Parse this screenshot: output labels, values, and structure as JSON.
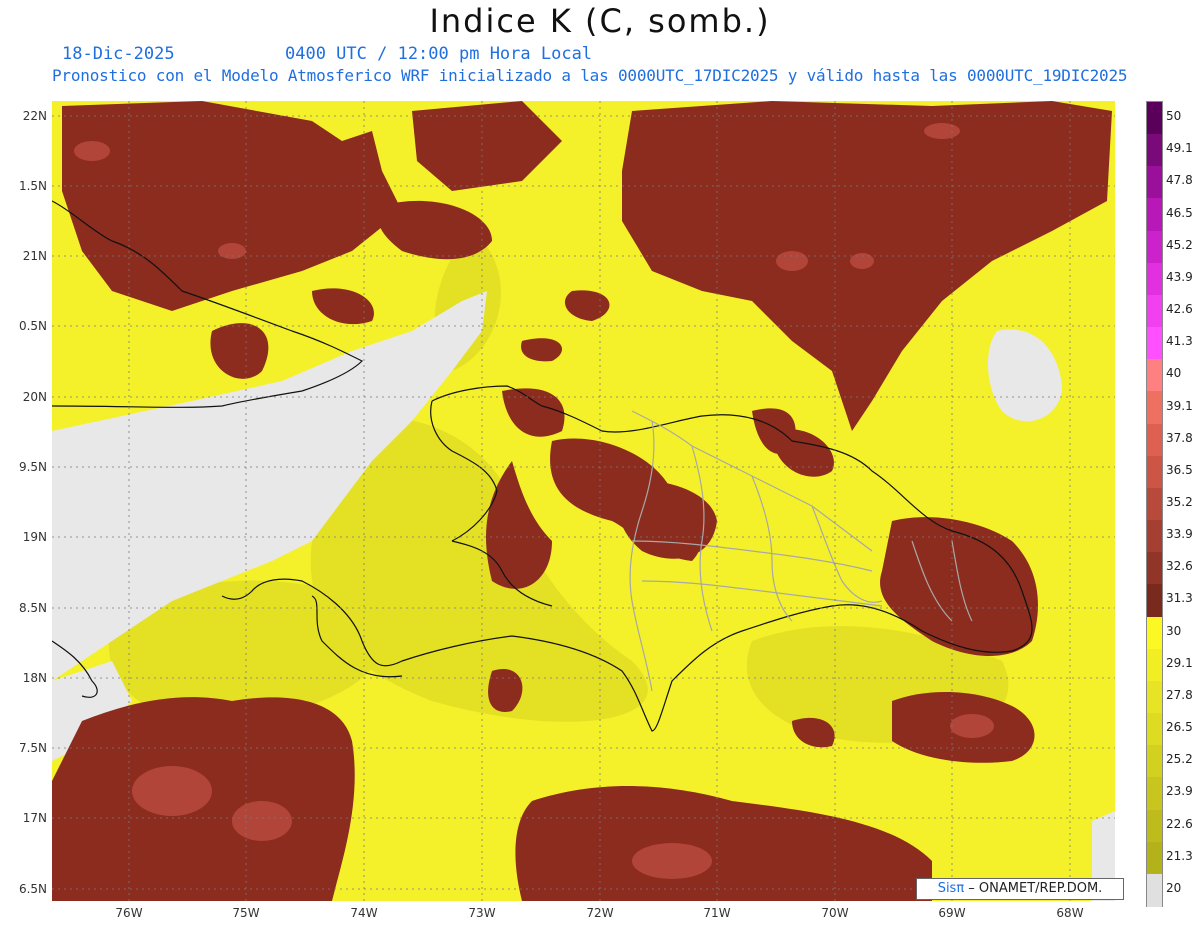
{
  "title": "Indice K (C, somb.)",
  "date": "18-Dic-2025",
  "time": "0400 UTC / 12:00 pm Hora Local",
  "forecast_line": "Pronostico con el Modelo Atmosferico WRF inicializado a las 0000UTC_17DIC2025 y válido hasta las  0000UTC_19DIC2025",
  "lat_labels": [
    "22N",
    "1.5N",
    "21N",
    "0.5N",
    "20N",
    "9.5N",
    "19N",
    "8.5N",
    "18N",
    "7.5N",
    "17N",
    "6.5N"
  ],
  "lon_labels": [
    "76W",
    "75W",
    "74W",
    "73W",
    "72W",
    "71W",
    "70W",
    "69W",
    "68W"
  ],
  "colorbar": {
    "labels": [
      "50",
      "49.1",
      "47.8",
      "46.5",
      "45.2",
      "43.9",
      "42.6",
      "41.3",
      "40",
      "39.1",
      "37.8",
      "36.5",
      "35.2",
      "33.9",
      "32.6",
      "31.3",
      "30",
      "29.1",
      "27.8",
      "26.5",
      "25.2",
      "23.9",
      "22.6",
      "21.3",
      "20"
    ],
    "colors": [
      "#5a005a",
      "#7a0a7a",
      "#9a109a",
      "#b818b8",
      "#cc22cc",
      "#e030e0",
      "#f040f0",
      "#ff50ff",
      "#ff8080",
      "#ee7060",
      "#dd6050",
      "#cc5545",
      "#b84a3c",
      "#a43f32",
      "#903528",
      "#7a2a1c",
      "#fbf824",
      "#f1ef24",
      "#e6e424",
      "#dddb22",
      "#d3d120",
      "#c8c61e",
      "#bebc1c",
      "#b4b21a",
      "#e0e0e0"
    ]
  },
  "credit": {
    "system": "Sisπ",
    "text": " – ONAMET/REP.DOM."
  }
}
